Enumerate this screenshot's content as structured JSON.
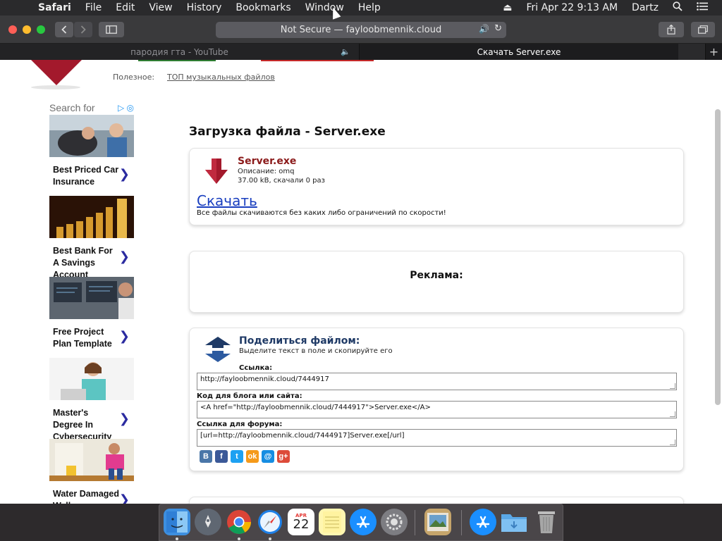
{
  "menubar": {
    "app": "Safari",
    "items": [
      "File",
      "Edit",
      "View",
      "History",
      "Bookmarks",
      "Window",
      "Help"
    ],
    "clock": "Fri Apr 22  9:13 AM",
    "user": "Dartz"
  },
  "toolbar": {
    "address": "Not Secure — fayloobmennik.cloud"
  },
  "tabs": [
    {
      "title": "пародия гта - YouTube"
    },
    {
      "title": "Скачать Server.exe"
    }
  ],
  "page": {
    "useful_label": "Полезное:",
    "useful_link": "ТОП музыкальных файлов",
    "title": "Загрузка файла - Server.exe",
    "file": {
      "name": "Server.exe",
      "description": "Описание: omq",
      "size_info": "37.00 kB, скачали 0 раз",
      "download_link": "Скачать",
      "download_note": "Все файлы скачиваются без каких либо ограничений по скорости!"
    },
    "ad_label": "Реклама:",
    "share": {
      "title": "Поделиться файлом:",
      "subtitle": "Выделите текст в поле и скопируйте его",
      "link_label": "Ссылка:",
      "link_value": "http://fayloobmennik.cloud/7444917",
      "blog_label": "Код для блога или сайта:",
      "blog_value": "<A href=\"http://fayloobmennik.cloud/7444917\">Server.exe</A>",
      "forum_label": "Ссылка для форума:",
      "forum_value": "[url=http://fayloobmennik.cloud/7444917]Server.exe[/url]",
      "social": [
        "B",
        "f",
        "t",
        "ok",
        "@",
        "g+"
      ]
    }
  },
  "ads": {
    "search_label": "Search for",
    "items": [
      {
        "text": "Best Priced Car Insurance"
      },
      {
        "text": "Best Bank For A Savings Account"
      },
      {
        "text": "Free Project Plan Template"
      },
      {
        "text": "Master's Degree In Cybersecurity"
      },
      {
        "text": "Water Damaged Wall"
      }
    ]
  },
  "dock": {
    "calendar_month": "APR",
    "calendar_day": "22"
  },
  "colors": {
    "brand_red": "#8b1a1a",
    "share_blue": "#1f3a66",
    "link_blue": "#1a3fbf",
    "ad_arrow": "#2b2ba0"
  }
}
